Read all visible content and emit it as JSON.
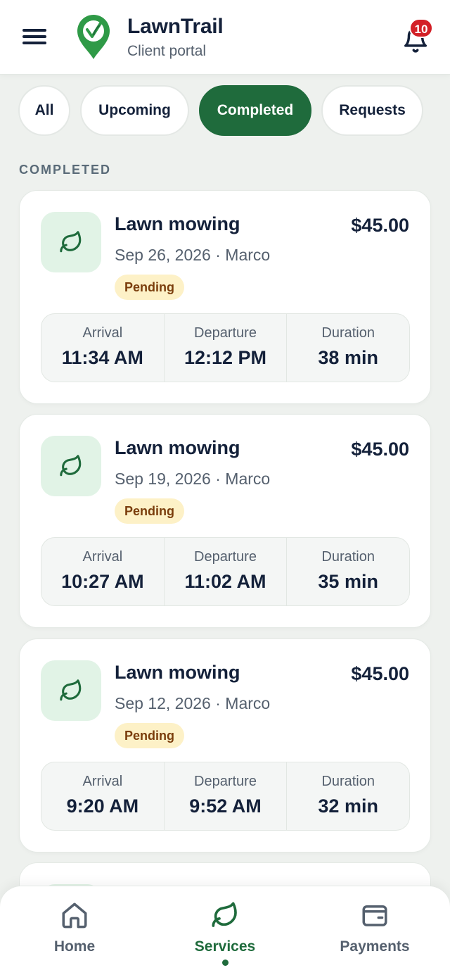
{
  "header": {
    "title": "LawnTrail",
    "subtitle": "Client portal",
    "notification_count": "10"
  },
  "tabs": [
    {
      "label": "All",
      "active": false
    },
    {
      "label": "Upcoming",
      "active": false
    },
    {
      "label": "Completed",
      "active": true
    },
    {
      "label": "Requests",
      "active": false
    }
  ],
  "section_label": "COMPLETED",
  "visits": [
    {
      "title": "Lawn mowing",
      "price": "$45.00",
      "meta": "Sep 26, 2026 · Marco",
      "status": "Pending",
      "arrival_label": "Arrival",
      "arrival": "11:34 AM",
      "departure_label": "Departure",
      "departure": "12:12 PM",
      "duration_label": "Duration",
      "duration": "38 min"
    },
    {
      "title": "Lawn mowing",
      "price": "$45.00",
      "meta": "Sep 19, 2026 · Marco",
      "status": "Pending",
      "arrival_label": "Arrival",
      "arrival": "10:27 AM",
      "departure_label": "Departure",
      "departure": "11:02 AM",
      "duration_label": "Duration",
      "duration": "35 min"
    },
    {
      "title": "Lawn mowing",
      "price": "$45.00",
      "meta": "Sep 12, 2026 · Marco",
      "status": "Pending",
      "arrival_label": "Arrival",
      "arrival": "9:20 AM",
      "departure_label": "Departure",
      "departure": "9:52 AM",
      "duration_label": "Duration",
      "duration": "32 min"
    }
  ],
  "bottom_nav": [
    {
      "label": "Home",
      "icon": "home-icon",
      "active": false
    },
    {
      "label": "Services",
      "icon": "leaf-icon",
      "active": true
    },
    {
      "label": "Payments",
      "icon": "wallet-icon",
      "active": false
    }
  ],
  "colors": {
    "brand_green": "#1f6b3c",
    "pending_bg": "#fdf1c7",
    "pending_text": "#7a3d0c",
    "badge_red": "#d32027"
  }
}
